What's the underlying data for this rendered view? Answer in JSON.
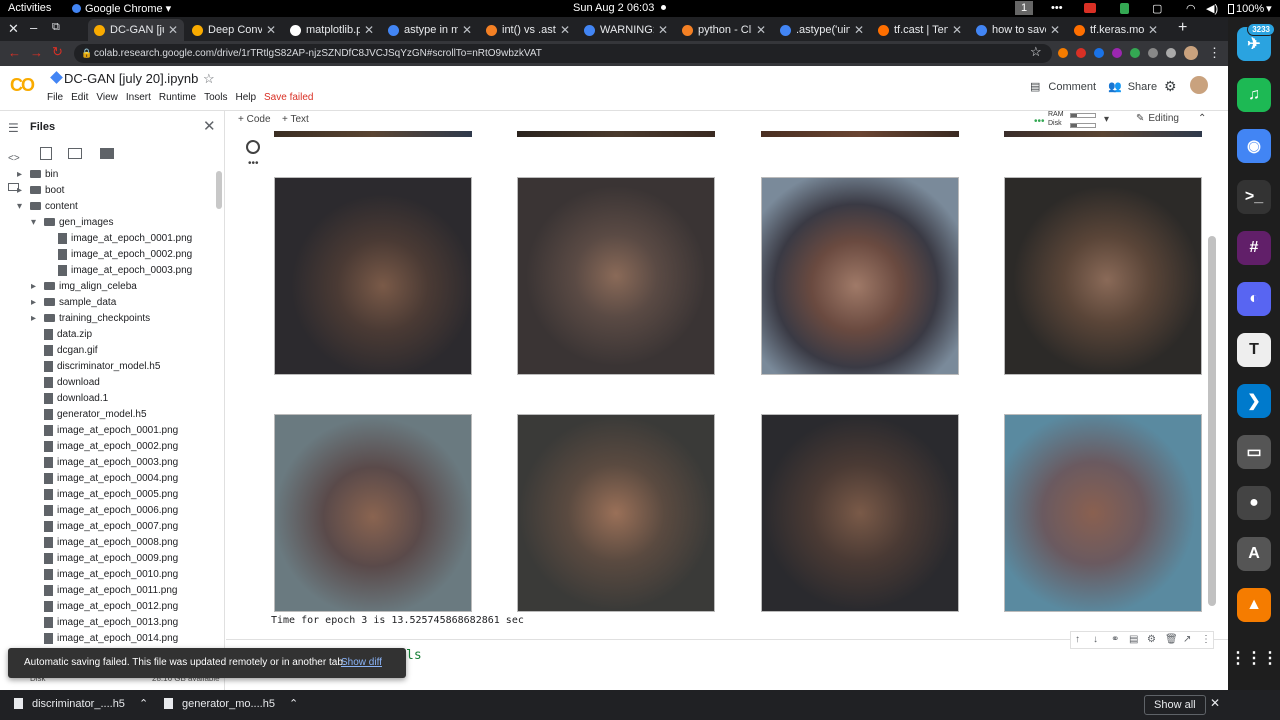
{
  "system": {
    "activities": "Activities",
    "app": "Google Chrome",
    "clock": "Sun Aug 2  06:03",
    "workspace": "1",
    "battery": "100%"
  },
  "tabs": [
    {
      "label": "DC-GAN [july",
      "color": "#f9ab00",
      "active": true
    },
    {
      "label": "Deep Convolu",
      "color": "#f9ab00",
      "active": false
    },
    {
      "label": "matplotlib.p",
      "color": "#ffffff",
      "active": false
    },
    {
      "label": "astype in ma",
      "color": "#4285f4",
      "active": false
    },
    {
      "label": "int() vs .asty",
      "color": "#f48024",
      "active": false
    },
    {
      "label": "WARNING:m",
      "color": "#4285f4",
      "active": false
    },
    {
      "label": "python - Clip",
      "color": "#f48024",
      "active": false
    },
    {
      "label": ".astype('uint",
      "color": "#4285f4",
      "active": false
    },
    {
      "label": "tf.cast | Ten",
      "color": "#ff6f00",
      "active": false
    },
    {
      "label": "how to save",
      "color": "#4285f4",
      "active": false
    },
    {
      "label": "tf.keras.mod",
      "color": "#ff6f00",
      "active": false
    }
  ],
  "url": "colab.research.google.com/drive/1rTRtlgS82AP-njzSZNDfC8JVCJSqYzGN#scrollTo=nRtO9wbzkVAT",
  "notebook": {
    "logo": "CO",
    "title": "DC-GAN [july 20].ipynb",
    "menu": [
      "File",
      "Edit",
      "View",
      "Insert",
      "Runtime",
      "Tools",
      "Help"
    ],
    "save_status": "Save failed",
    "comment": "Comment",
    "share": "Share"
  },
  "files_panel": {
    "title": "Files",
    "items": [
      {
        "name": "bin",
        "type": "folder",
        "level": 0,
        "arrow": "▸"
      },
      {
        "name": "boot",
        "type": "folder",
        "level": 0,
        "arrow": "▸"
      },
      {
        "name": "content",
        "type": "folder",
        "level": 0,
        "arrow": "▾"
      },
      {
        "name": "gen_images",
        "type": "folder",
        "level": 1,
        "arrow": "▾"
      },
      {
        "name": "image_at_epoch_0001.png",
        "type": "file",
        "level": 2,
        "arrow": ""
      },
      {
        "name": "image_at_epoch_0002.png",
        "type": "file",
        "level": 2,
        "arrow": ""
      },
      {
        "name": "image_at_epoch_0003.png",
        "type": "file",
        "level": 2,
        "arrow": ""
      },
      {
        "name": "img_align_celeba",
        "type": "folder",
        "level": 1,
        "arrow": "▸"
      },
      {
        "name": "sample_data",
        "type": "folder",
        "level": 1,
        "arrow": "▸"
      },
      {
        "name": "training_checkpoints",
        "type": "folder",
        "level": 1,
        "arrow": "▸"
      },
      {
        "name": "data.zip",
        "type": "file",
        "level": 1,
        "arrow": ""
      },
      {
        "name": "dcgan.gif",
        "type": "file",
        "level": 1,
        "arrow": ""
      },
      {
        "name": "discriminator_model.h5",
        "type": "file",
        "level": 1,
        "arrow": ""
      },
      {
        "name": "download",
        "type": "file",
        "level": 1,
        "arrow": ""
      },
      {
        "name": "download.1",
        "type": "file",
        "level": 1,
        "arrow": ""
      },
      {
        "name": "generator_model.h5",
        "type": "file",
        "level": 1,
        "arrow": ""
      },
      {
        "name": "image_at_epoch_0001.png",
        "type": "file",
        "level": 1,
        "arrow": ""
      },
      {
        "name": "image_at_epoch_0002.png",
        "type": "file",
        "level": 1,
        "arrow": ""
      },
      {
        "name": "image_at_epoch_0003.png",
        "type": "file",
        "level": 1,
        "arrow": ""
      },
      {
        "name": "image_at_epoch_0004.png",
        "type": "file",
        "level": 1,
        "arrow": ""
      },
      {
        "name": "image_at_epoch_0005.png",
        "type": "file",
        "level": 1,
        "arrow": ""
      },
      {
        "name": "image_at_epoch_0006.png",
        "type": "file",
        "level": 1,
        "arrow": ""
      },
      {
        "name": "image_at_epoch_0007.png",
        "type": "file",
        "level": 1,
        "arrow": ""
      },
      {
        "name": "image_at_epoch_0008.png",
        "type": "file",
        "level": 1,
        "arrow": ""
      },
      {
        "name": "image_at_epoch_0009.png",
        "type": "file",
        "level": 1,
        "arrow": ""
      },
      {
        "name": "image_at_epoch_0010.png",
        "type": "file",
        "level": 1,
        "arrow": ""
      },
      {
        "name": "image_at_epoch_0011.png",
        "type": "file",
        "level": 1,
        "arrow": ""
      },
      {
        "name": "image_at_epoch_0012.png",
        "type": "file",
        "level": 1,
        "arrow": ""
      },
      {
        "name": "image_at_epoch_0013.png",
        "type": "file",
        "level": 1,
        "arrow": ""
      },
      {
        "name": "image_at_epoch_0014.png",
        "type": "file",
        "level": 1,
        "arrow": ""
      }
    ],
    "disk_label": "Disk",
    "disk_available": "28.16 GB available"
  },
  "cell_toolbar": {
    "add_code": "+ Code",
    "add_text": "+ Text",
    "ram": "RAM",
    "disk": "Disk",
    "editing": "Editing"
  },
  "output": {
    "epoch_text": "Time for epoch 3 is 13.525745868682861 sec",
    "next_cell_partial": "ls"
  },
  "toast": {
    "message": "Automatic saving failed. This file was updated remotely or in another tab.",
    "action": "Show diff"
  },
  "downloads": [
    {
      "name": "discriminator_....h5"
    },
    {
      "name": "generator_mo....h5"
    }
  ],
  "show_all": "Show all",
  "dock_apps": [
    {
      "name": "telegram",
      "glyph": "✈",
      "color": "#2aa3e0",
      "badge": "3233"
    },
    {
      "name": "spotify",
      "glyph": "♫",
      "color": "#1db954",
      "badge": ""
    },
    {
      "name": "chrome",
      "glyph": "◉",
      "color": "#4285f4",
      "badge": ""
    },
    {
      "name": "terminal",
      "glyph": ">_",
      "color": "#333333",
      "badge": ""
    },
    {
      "name": "slack",
      "glyph": "#",
      "color": "#611f69",
      "badge": ""
    },
    {
      "name": "discord",
      "glyph": "◐",
      "color": "#5865f2",
      "badge": ""
    },
    {
      "name": "typora",
      "glyph": "T",
      "color": "#eeeeee",
      "badge": ""
    },
    {
      "name": "vscode",
      "glyph": "❯",
      "color": "#007acc",
      "badge": ""
    },
    {
      "name": "files",
      "glyph": "▭",
      "color": "#555555",
      "badge": ""
    },
    {
      "name": "webcam",
      "glyph": "●",
      "color": "#444444",
      "badge": ""
    },
    {
      "name": "software-updater",
      "glyph": "A",
      "color": "#555555",
      "badge": ""
    },
    {
      "name": "vlc",
      "glyph": "▲",
      "color": "#f57c00",
      "badge": ""
    },
    {
      "name": "app-grid",
      "glyph": "⋮⋮⋮",
      "color": "#1e1e1e",
      "badge": ""
    }
  ]
}
